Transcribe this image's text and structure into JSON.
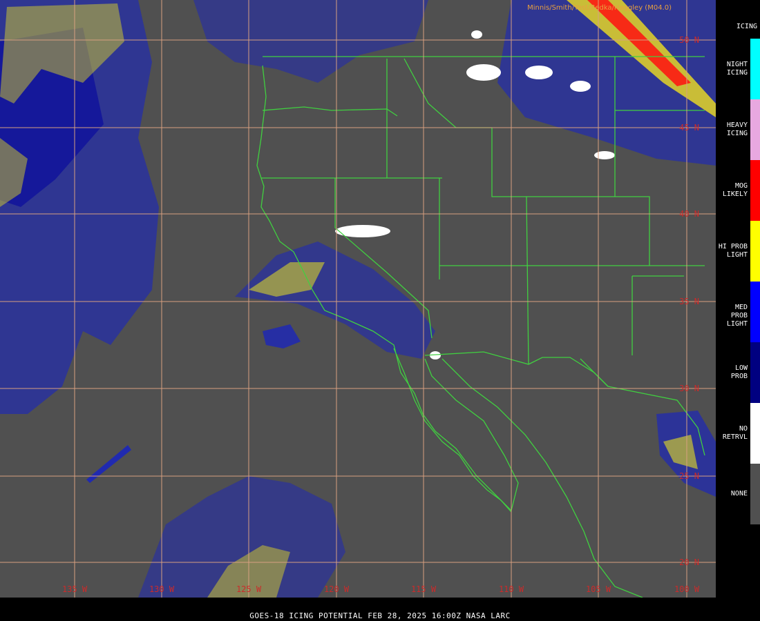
{
  "credit": "Minnis/Smith/Yost/Bedka/Haggley (M04.0)",
  "legend": {
    "title": "ICING",
    "items": [
      {
        "label": "NIGHT\nICING",
        "color": "#00ffff"
      },
      {
        "label": "HEAVY\nICING",
        "color": "#e8a8e0"
      },
      {
        "label": "MOG\nLIKELY",
        "color": "#ff0000"
      },
      {
        "label": "HI PROB\nLIGHT",
        "color": "#ffff00"
      },
      {
        "label": "MED PROB\nLIGHT",
        "color": "#0000ff"
      },
      {
        "label": "LOW\nPROB",
        "color": "#000080"
      },
      {
        "label": "NO\nRETRVL",
        "color": "#ffffff"
      },
      {
        "label": "NONE",
        "color": "#505050"
      }
    ]
  },
  "grid": {
    "lat_labels": [
      "50 N",
      "45 N",
      "40 N",
      "35 N",
      "30 N",
      "25 N",
      "20 N"
    ],
    "lon_labels": [
      "135 W",
      "130 W",
      "125 W",
      "120 W",
      "115 W",
      "110 W",
      "105 W",
      "100 W"
    ],
    "line_color": "#d8a080"
  },
  "footer": "GOES-18  ICING POTENTIAL   FEB 28, 2025 16:00Z   NASA LARC"
}
